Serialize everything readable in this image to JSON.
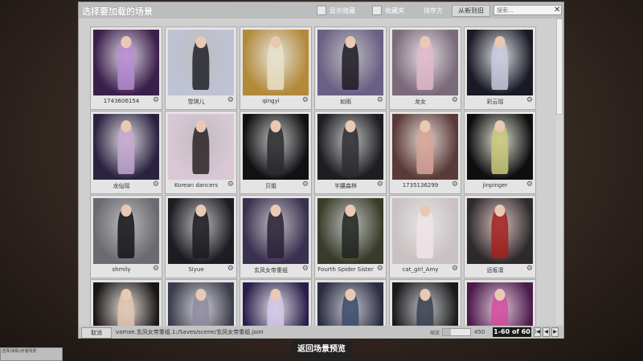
{
  "header": {
    "title": "选择要加载的场景",
    "show_hidden_label": "显示隐藏",
    "favorites_label": "收藏夹",
    "sort_label": "排序方",
    "sort_value": "从新到旧",
    "search_placeholder": "搜索..."
  },
  "cards": [
    {
      "label": "1743606154",
      "bg": "#3a1f4a",
      "fig": "#b58bd1"
    },
    {
      "label": "雪琪儿",
      "bg": "#bfc2d4",
      "fig": "#222228"
    },
    {
      "label": "qingyi",
      "bg": "#b38a3a",
      "fig": "#e8e0c8"
    },
    {
      "label": "如雨",
      "bg": "#6a5f84",
      "fig": "#1c1a22"
    },
    {
      "label": "龙女",
      "bg": "#7a6a7a",
      "fig": "#e0b9c8"
    },
    {
      "label": "彩云瑶",
      "bg": "#1a1a26",
      "fig": "#c8c9dc"
    },
    {
      "label": "龙仙瑶",
      "bg": "#2a2340",
      "fig": "#c3a7d0"
    },
    {
      "label": "Korean dancers",
      "bg": "#d9c7d6",
      "fig": "#2a2224"
    },
    {
      "label": "贝姐",
      "bg": "#111114",
      "fig": "#2a2a2e"
    },
    {
      "label": "半腰森林",
      "bg": "#1d1d22",
      "fig": "#2c2c30"
    },
    {
      "label": "1735136299",
      "bg": "#5a3a38",
      "fig": "#d7a398"
    },
    {
      "label": "jinpinger",
      "bg": "#0e0e10",
      "fig": "#c9c97a"
    },
    {
      "label": "shmily",
      "bg": "#6a6a70",
      "fig": "#141416"
    },
    {
      "label": "Siyue",
      "bg": "#1c1c22",
      "fig": "#1a1a1e"
    },
    {
      "label": "玄凤女帝重组",
      "bg": "#3a3050",
      "fig": "#2a2036"
    },
    {
      "label": "Fourth Spider Sister",
      "bg": "#3a3c2a",
      "fig": "#1e241e"
    },
    {
      "label": "cat_girl_Amy",
      "bg": "#c9c1c2",
      "fig": "#efe3e6"
    },
    {
      "label": "远坂凛",
      "bg": "#2e2a2c",
      "fig": "#a4201e"
    },
    {
      "label": "",
      "bg": "#1a1614",
      "fig": "#e2c4b0"
    },
    {
      "label": "",
      "bg": "#3a3c4a",
      "fig": "#8d8aa0"
    },
    {
      "label": "",
      "bg": "#2a1e4a",
      "fig": "#d4c8e8"
    },
    {
      "label": "",
      "bg": "#2a2c40",
      "fig": "#3a4a6a"
    },
    {
      "label": "",
      "bg": "#1a1a1c",
      "fig": "#3a4050"
    },
    {
      "label": "",
      "bg": "#4a1a4a",
      "fig": "#d44aa0"
    }
  ],
  "footer": {
    "cancel_label": "取消",
    "path": "vamxe.玄凤女帝重组.1:/Saves/scene/玄凤女帝重组.json",
    "zoom_label": "缩放",
    "zoom_value": "450",
    "zoom_fraction": 0.3,
    "page_info": "1-60 of 60"
  },
  "back_button_label": "返回场景预览",
  "corner_text": "选择/读取/存储场景"
}
